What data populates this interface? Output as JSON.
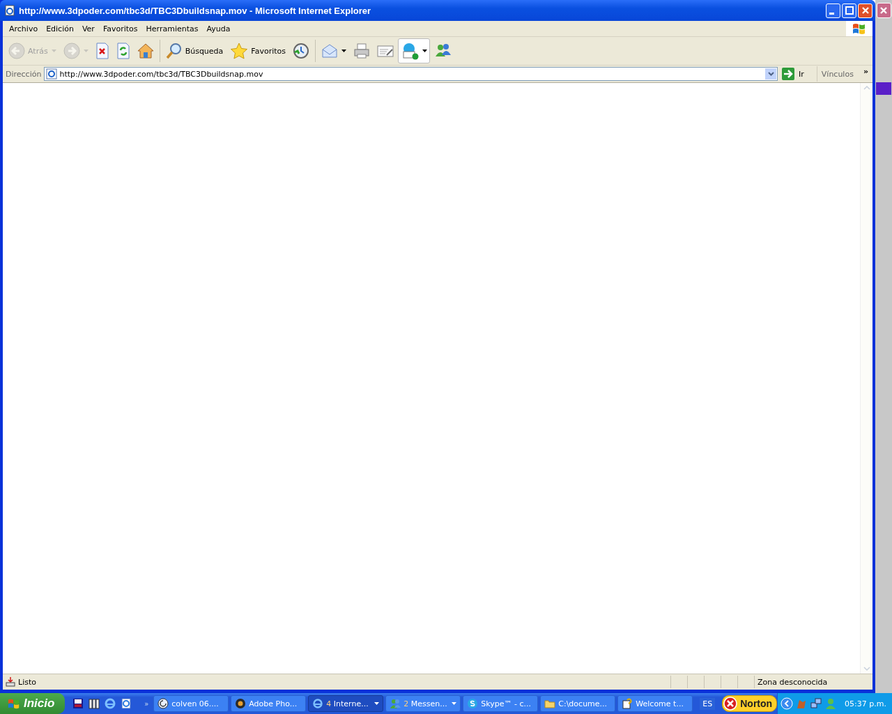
{
  "window": {
    "title": "http://www.3dpoder.com/tbc3d/TBC3Dbuildsnap.mov - Microsoft Internet Explorer"
  },
  "menu": [
    "Archivo",
    "Edición",
    "Ver",
    "Favoritos",
    "Herramientas",
    "Ayuda"
  ],
  "toolbar": [
    {
      "kind": "back",
      "label": "Atrás",
      "disabled": true,
      "dropdown": true,
      "pressed": false
    },
    {
      "kind": "forward",
      "disabled": true,
      "dropdown": true,
      "pressed": false
    },
    {
      "kind": "stop",
      "disabled": false,
      "dropdown": false,
      "pressed": false
    },
    {
      "kind": "refresh",
      "disabled": false,
      "dropdown": false,
      "pressed": false
    },
    {
      "kind": "home",
      "disabled": false,
      "dropdown": false,
      "pressed": false
    },
    {
      "kind": "search",
      "label": "Búsqueda",
      "disabled": false,
      "dropdown": false,
      "pressed": false
    },
    {
      "kind": "favorites",
      "label": "Favoritos",
      "disabled": false,
      "dropdown": false,
      "pressed": false
    },
    {
      "kind": "history",
      "disabled": false,
      "dropdown": false,
      "pressed": false
    },
    {
      "kind": "mail",
      "disabled": false,
      "dropdown": true,
      "pressed": false
    },
    {
      "kind": "print",
      "disabled": false,
      "dropdown": false,
      "pressed": false
    },
    {
      "kind": "edit",
      "disabled": false,
      "dropdown": false,
      "pressed": false
    },
    {
      "kind": "skype",
      "disabled": false,
      "dropdown": true,
      "pressed": true
    },
    {
      "kind": "messenger",
      "disabled": false,
      "dropdown": false,
      "pressed": false
    }
  ],
  "address": {
    "label": "Dirección",
    "value": "http://www.3dpoder.com/tbc3d/TBC3Dbuildsnap.mov",
    "go": "Ir",
    "links": "Vínculos",
    "more": "»"
  },
  "status_bar": {
    "text": "Listo",
    "zone": "Zona desconocida"
  },
  "taskbar": {
    "start": "Inicio",
    "more": "»",
    "buttons": [
      {
        "label": "colven 06....",
        "selected": false
      },
      {
        "label": "Adobe Pho...",
        "selected": false
      },
      {
        "count": "4",
        "label": "Interne...",
        "selected": true
      },
      {
        "count": "2",
        "label": "Messen...",
        "selected": false
      },
      {
        "label": "Skype™ - c...",
        "selected": false
      },
      {
        "label": "C:\\docume...",
        "selected": false
      },
      {
        "label": "Welcome t...",
        "selected": false
      }
    ],
    "language": "ES",
    "norton": "Norton",
    "clock": "05:37 p.m."
  }
}
